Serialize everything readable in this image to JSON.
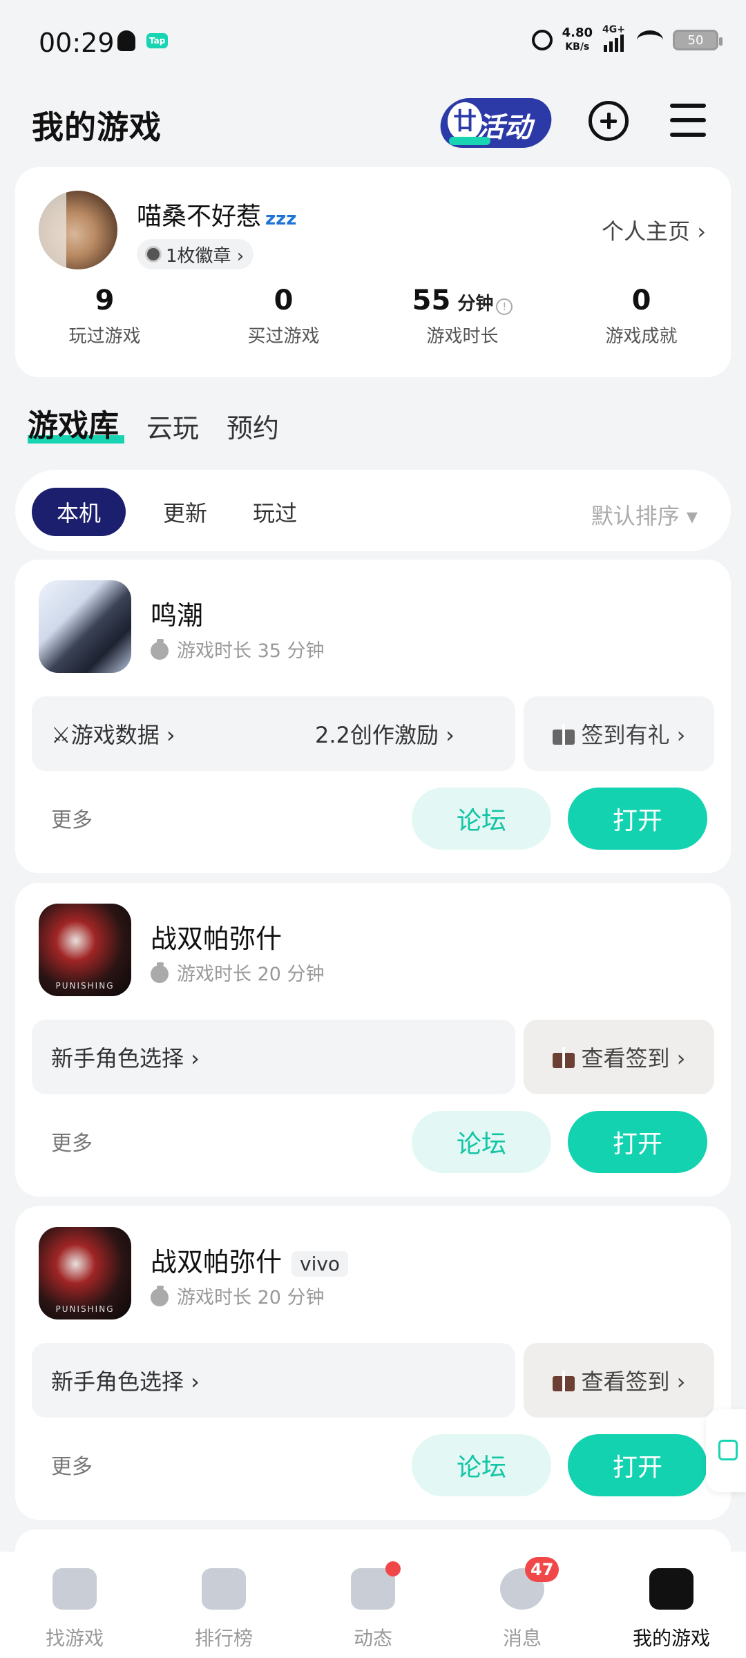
{
  "status_bar": {
    "time": "00:29",
    "tap_badge": "Tap",
    "net_speed": "4.80",
    "net_unit": "KB/s",
    "net_type": "4G+",
    "battery": "50"
  },
  "header": {
    "title": "我的游戏",
    "activity_label": "活动"
  },
  "profile": {
    "username": "喵桑不好惹",
    "zzz": "zzz",
    "medal_label": "1枚徽章 ›",
    "homepage_label": "个人主页 ›",
    "stats": [
      {
        "num": "9",
        "unit": "",
        "label": "玩过游戏"
      },
      {
        "num": "0",
        "unit": "",
        "label": "买过游戏"
      },
      {
        "num": "55",
        "unit": "分钟",
        "label": "游戏时长"
      },
      {
        "num": "0",
        "unit": "",
        "label": "游戏成就"
      }
    ]
  },
  "tabs": [
    "游戏库",
    "云玩",
    "预约"
  ],
  "filter": {
    "chips": [
      "本机",
      "更新",
      "玩过"
    ],
    "sort_label": "默认排序 ▾"
  },
  "games": [
    {
      "name": "鸣潮",
      "tag": "",
      "time": "游戏时长 35 分钟",
      "row_left": "⚔游戏数据 ›",
      "row_left2": "2.2创作激励 ›",
      "row_right": "签到有礼 ›",
      "more": "更多",
      "forum": "论坛",
      "open": "打开"
    },
    {
      "name": "战双帕弥什",
      "tag": "",
      "time": "游戏时长 20 分钟",
      "row_left": "新手角色选择 ›",
      "row_left2": "",
      "row_right": "查看签到 ›",
      "more": "更多",
      "forum": "论坛",
      "open": "打开"
    },
    {
      "name": "战双帕弥什",
      "tag": "vivo",
      "time": "游戏时长 20 分钟",
      "row_left": "新手角色选择 ›",
      "row_left2": "",
      "row_right": "查看签到 ›",
      "more": "更多",
      "forum": "论坛",
      "open": "打开"
    }
  ],
  "bottom_nav": [
    {
      "label": "找游戏",
      "badge": ""
    },
    {
      "label": "排行榜",
      "badge": ""
    },
    {
      "label": "动态",
      "badge": "dot"
    },
    {
      "label": "消息",
      "badge": "47"
    },
    {
      "label": "我的游戏",
      "badge": ""
    }
  ]
}
